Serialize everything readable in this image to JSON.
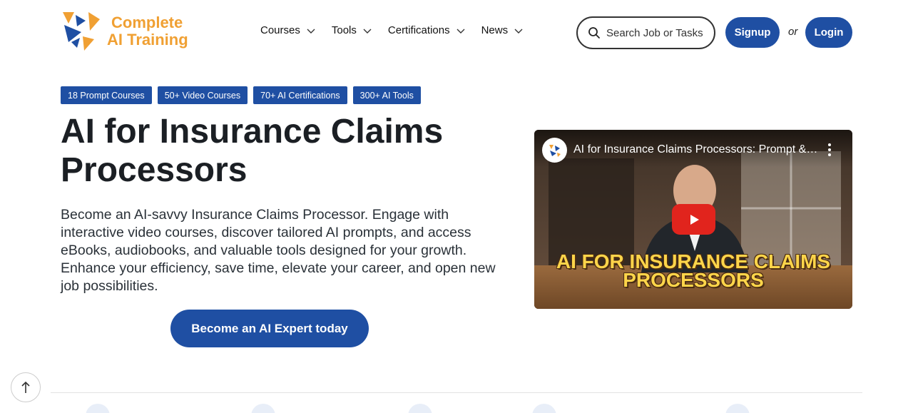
{
  "brand": {
    "line1": "Complete",
    "line2": "AI Training",
    "colors": {
      "orange": "#f0a033",
      "blue": "#1f4fa3"
    }
  },
  "nav": {
    "items": [
      {
        "label": "Courses"
      },
      {
        "label": "Tools"
      },
      {
        "label": "Certifications"
      },
      {
        "label": "News"
      }
    ]
  },
  "search": {
    "placeholder": "Search Job or Tasks"
  },
  "auth": {
    "signup": "Signup",
    "or": "or",
    "login": "Login"
  },
  "badges": [
    "18 Prompt Courses",
    "50+ Video Courses",
    "70+ AI Certifications",
    "300+ AI Tools"
  ],
  "hero": {
    "title": "AI for Insurance Claims Processors",
    "description": "Become an AI-savvy Insurance Claims Processor. Engage with interactive video courses, discover tailored AI prompts, and access eBooks, audiobooks, and valuable tools designed for your growth. Enhance your efficiency, save time, elevate your career, and open new job possibilities.",
    "cta": "Become an AI Expert today"
  },
  "video": {
    "title": "AI for Insurance Claims Processors: Prompt & Learning Guide",
    "caption_line1": "AI FOR INSURANCE CLAIMS",
    "caption_line2": "PROCESSORS"
  }
}
